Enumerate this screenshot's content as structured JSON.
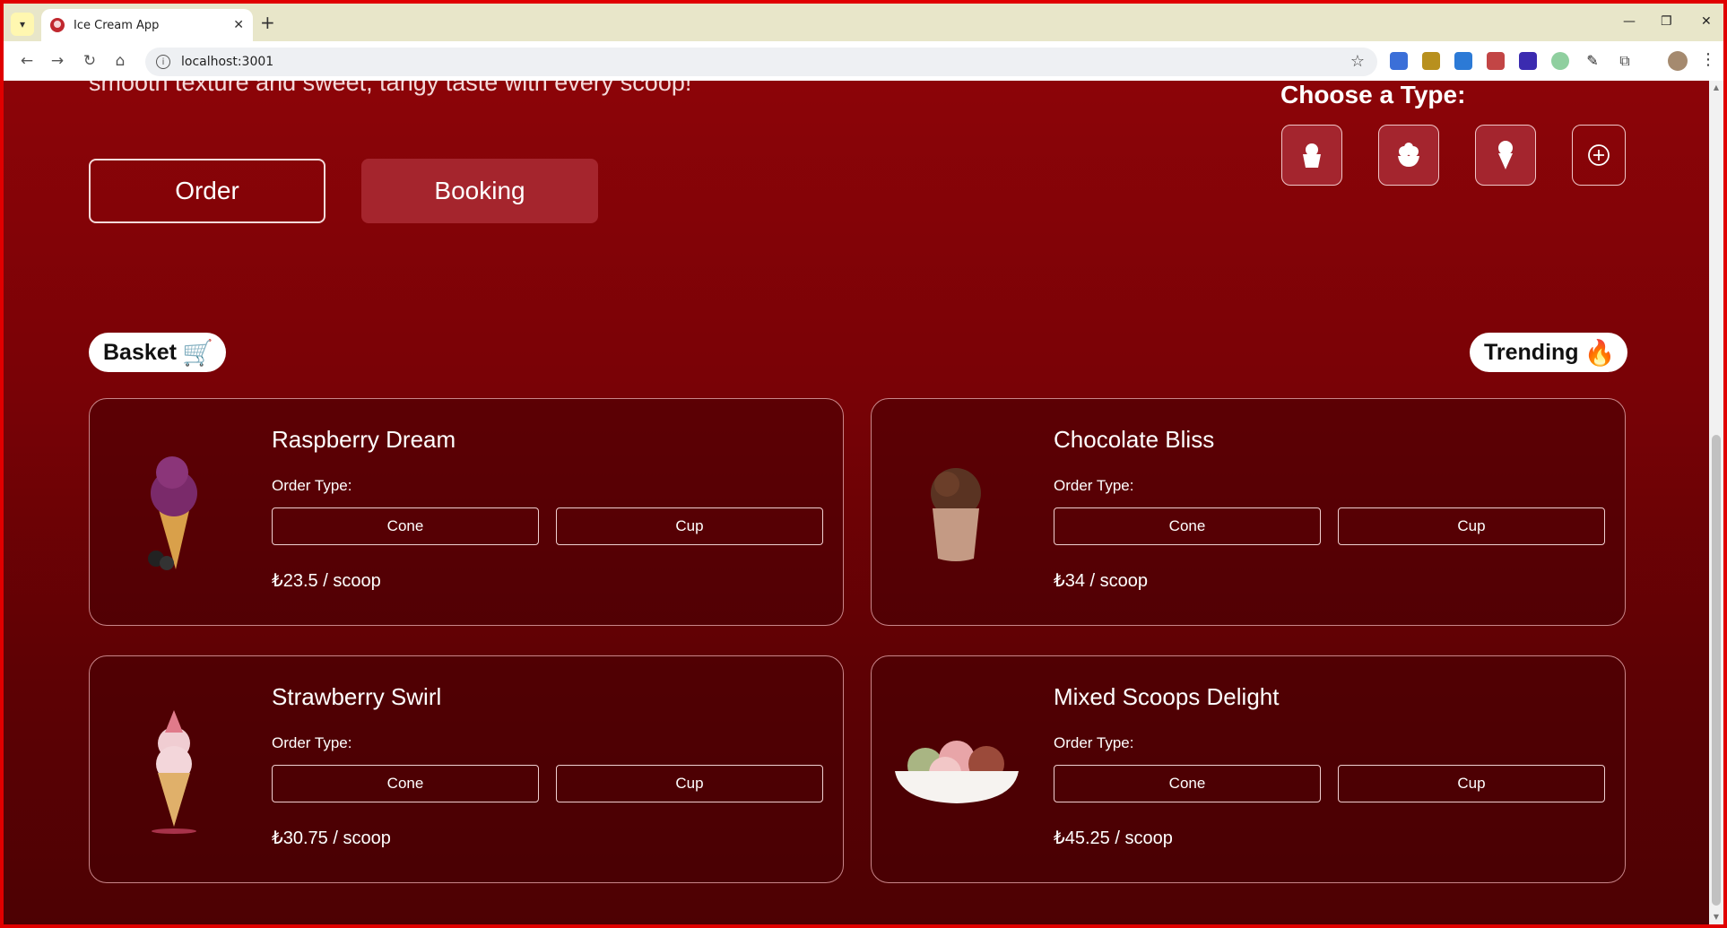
{
  "browser": {
    "tab_title": "Ice Cream App",
    "url": "localhost:3001"
  },
  "hero": {
    "text": "smooth texture and sweet, tangy taste with every scoop!",
    "order_label": "Order",
    "booking_label": "Booking"
  },
  "types": {
    "label": "Choose a Type:",
    "items": [
      "cup-icon",
      "bowl-icon",
      "cone-icon",
      "add-icon"
    ]
  },
  "basket": {
    "label": "Basket",
    "emoji": "🛒"
  },
  "trending": {
    "label": "Trending",
    "emoji": "🔥"
  },
  "products": [
    {
      "name": "Raspberry Dream",
      "order_type_label": "Order Type:",
      "cone_label": "Cone",
      "cup_label": "Cup",
      "price": "₺23.5 / scoop"
    },
    {
      "name": "Chocolate Bliss",
      "order_type_label": "Order Type:",
      "cone_label": "Cone",
      "cup_label": "Cup",
      "price": "₺34 / scoop"
    },
    {
      "name": "Strawberry Swirl",
      "order_type_label": "Order Type:",
      "cone_label": "Cone",
      "cup_label": "Cup",
      "price": "₺30.75 / scoop"
    },
    {
      "name": "Mixed Scoops Delight",
      "order_type_label": "Order Type:",
      "cone_label": "Cone",
      "cup_label": "Cup",
      "price": "₺45.25 / scoop"
    }
  ],
  "colors": {
    "background_top": "#8c0408",
    "background_bottom": "#4d0103",
    "booking_button": "#a5252d",
    "frame_border": "#e00000"
  }
}
